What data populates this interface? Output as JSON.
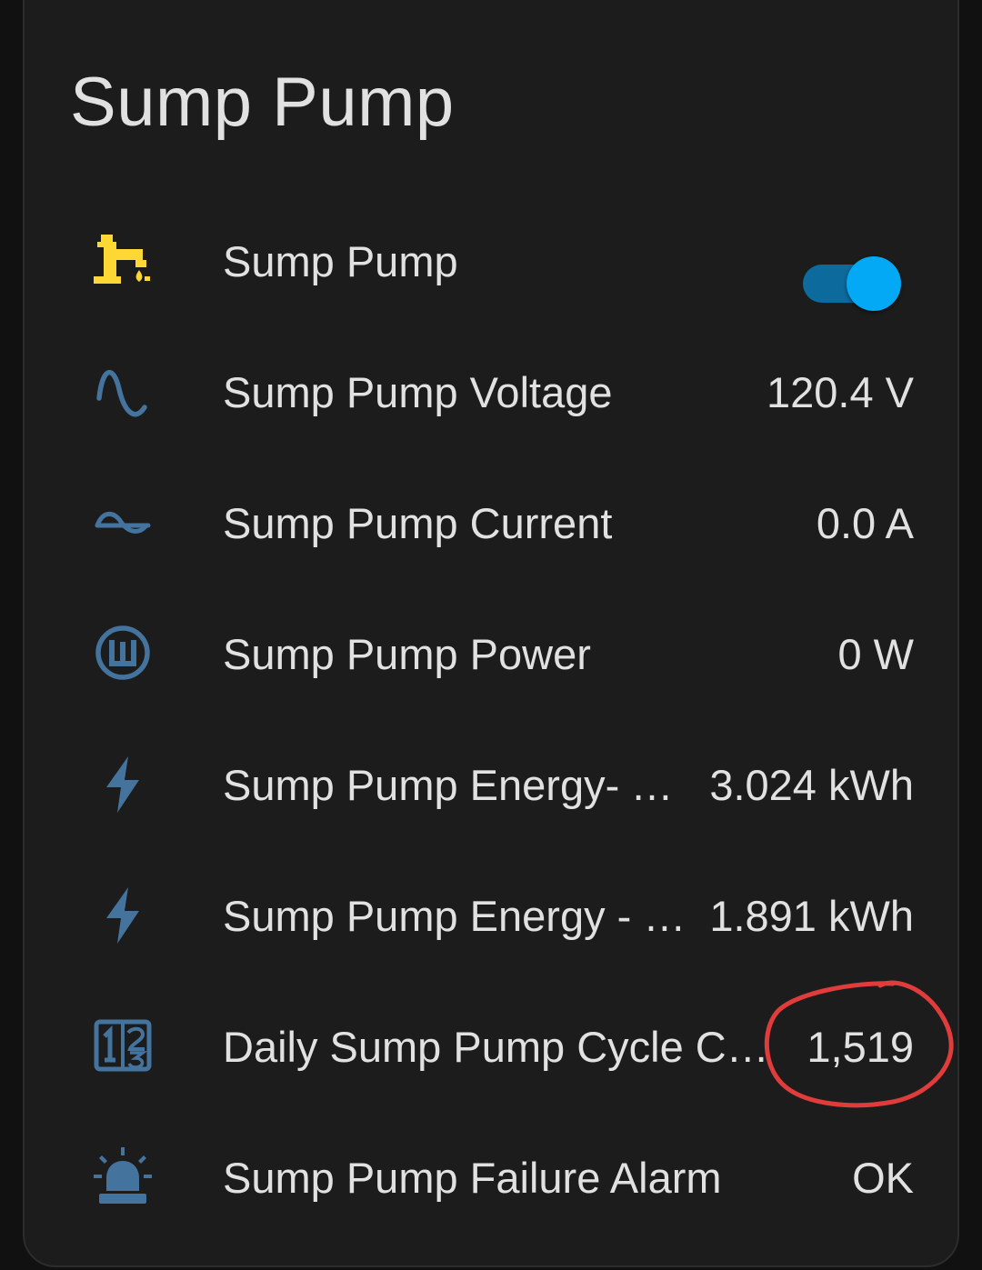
{
  "card": {
    "title": "Sump Pump"
  },
  "colors": {
    "card_background": "#1c1c1c",
    "text": "#e1e1e1",
    "icon_default": "#44739e",
    "icon_active": "#fdd835",
    "toggle_on": "#03a9f4",
    "annotation": "#e03c3c"
  },
  "entities": [
    {
      "icon": "water-pump-icon",
      "name": "Sump Pump",
      "control": "toggle",
      "state": "on"
    },
    {
      "icon": "sine-wave-icon",
      "name": "Sump Pump Voltage",
      "value": "120.4 V"
    },
    {
      "icon": "current-ac-icon",
      "name": "Sump Pump Current",
      "value": "0.0 A"
    },
    {
      "icon": "alpha-w-circle-icon",
      "name": "Sump Pump Power",
      "value": "0 W"
    },
    {
      "icon": "flash-icon",
      "name": "Sump Pump Energy- T…",
      "value": "3.024 kWh"
    },
    {
      "icon": "flash-icon",
      "name": "Sump Pump Energy - …",
      "value": "1.891 kWh"
    },
    {
      "icon": "numeric-icon",
      "name": "Daily Sump Pump Cycle Co…",
      "value": "1,519"
    },
    {
      "icon": "alarm-light-icon",
      "name": "Sump Pump Failure Alarm",
      "value": "OK"
    }
  ]
}
